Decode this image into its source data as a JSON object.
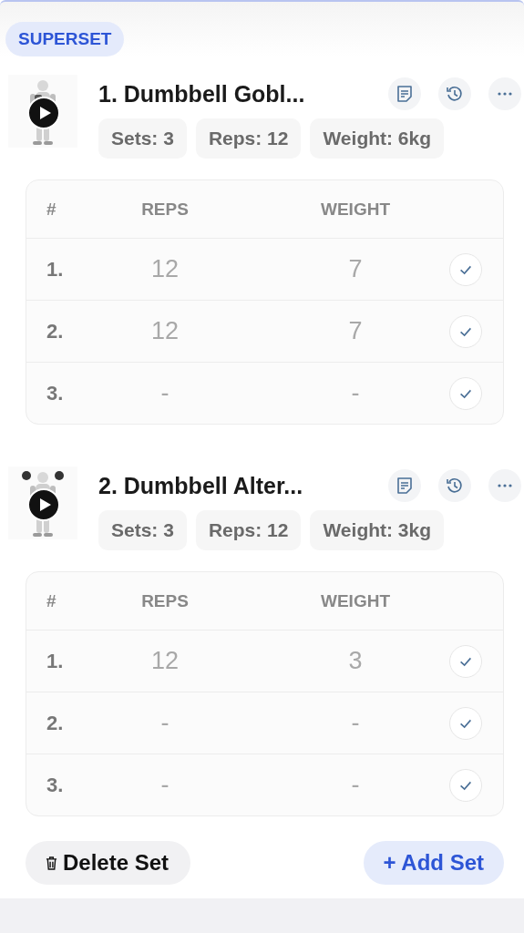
{
  "badge": "SUPERSET",
  "exercises": [
    {
      "title": "1. Dumbbell Gobl...",
      "chips": [
        "Sets: 3",
        "Reps: 12",
        "Weight: 6kg"
      ],
      "columns": [
        "#",
        "REPS",
        "WEIGHT"
      ],
      "rows": [
        {
          "index": "1.",
          "reps": "12",
          "weight": "7"
        },
        {
          "index": "2.",
          "reps": "12",
          "weight": "7"
        },
        {
          "index": "3.",
          "reps": "-",
          "weight": "-"
        }
      ]
    },
    {
      "title": "2. Dumbbell Alter...",
      "chips": [
        "Sets: 3",
        "Reps: 12",
        "Weight: 3kg"
      ],
      "columns": [
        "#",
        "REPS",
        "WEIGHT"
      ],
      "rows": [
        {
          "index": "1.",
          "reps": "12",
          "weight": "3"
        },
        {
          "index": "2.",
          "reps": "-",
          "weight": "-"
        },
        {
          "index": "3.",
          "reps": "-",
          "weight": "-"
        }
      ]
    }
  ],
  "actions": {
    "delete": "Delete Set",
    "add": "+ Add Set"
  }
}
